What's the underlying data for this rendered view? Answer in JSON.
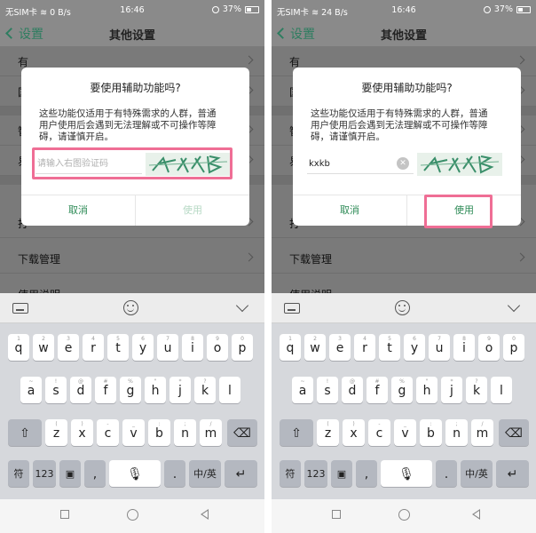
{
  "status": {
    "carrier": "无SIM卡",
    "wifi_icon": "wifi-icon",
    "left_speed": "0 B/s",
    "right_speed": "24 B/s",
    "time": "16:46",
    "battery": "37%"
  },
  "header": {
    "back_label": "设置",
    "title": "其他设置"
  },
  "list_items": [
    "有",
    "国",
    "智",
    "易",
    "打",
    "下载管理",
    "使用说明"
  ],
  "dialog": {
    "title": "要使用辅助功能吗?",
    "body_lines": [
      "这些功能仅适用于有特殊需求的人群，普通",
      "用户使用后会遇到无法理解或不可操作等障",
      "碍，请谨慎开启。"
    ],
    "placeholder": "请输入右图验证码",
    "captcha_text": "kxkb",
    "cancel": "取消",
    "confirm": "使用"
  },
  "right": {
    "entered_code": "kxkb"
  },
  "keyboard": {
    "row1": [
      "q",
      "w",
      "e",
      "r",
      "t",
      "y",
      "u",
      "i",
      "o",
      "p"
    ],
    "row1_hints": [
      "1",
      "2",
      "3",
      "4",
      "5",
      "6",
      "7",
      "8",
      "9",
      "0"
    ],
    "row2": [
      "a",
      "s",
      "d",
      "f",
      "g",
      "h",
      "j",
      "k",
      "l"
    ],
    "row2_hints": [
      "~",
      "!",
      "@",
      "#",
      "%",
      "\"",
      "*",
      "?",
      ""
    ],
    "row3": [
      "z",
      "x",
      "c",
      "v",
      "b",
      "n",
      "m"
    ],
    "row3_hints": [
      "(",
      ")",
      "-",
      "_",
      ":",
      ";",
      "/"
    ],
    "fn": {
      "symbols": "符",
      "numbers": "123",
      "comma": ",",
      "period": ".",
      "lang": "中/英"
    }
  },
  "colors": {
    "accent": "#2e8b57",
    "highlight": "#ef6e95",
    "disabled": "#b7d9c5"
  }
}
